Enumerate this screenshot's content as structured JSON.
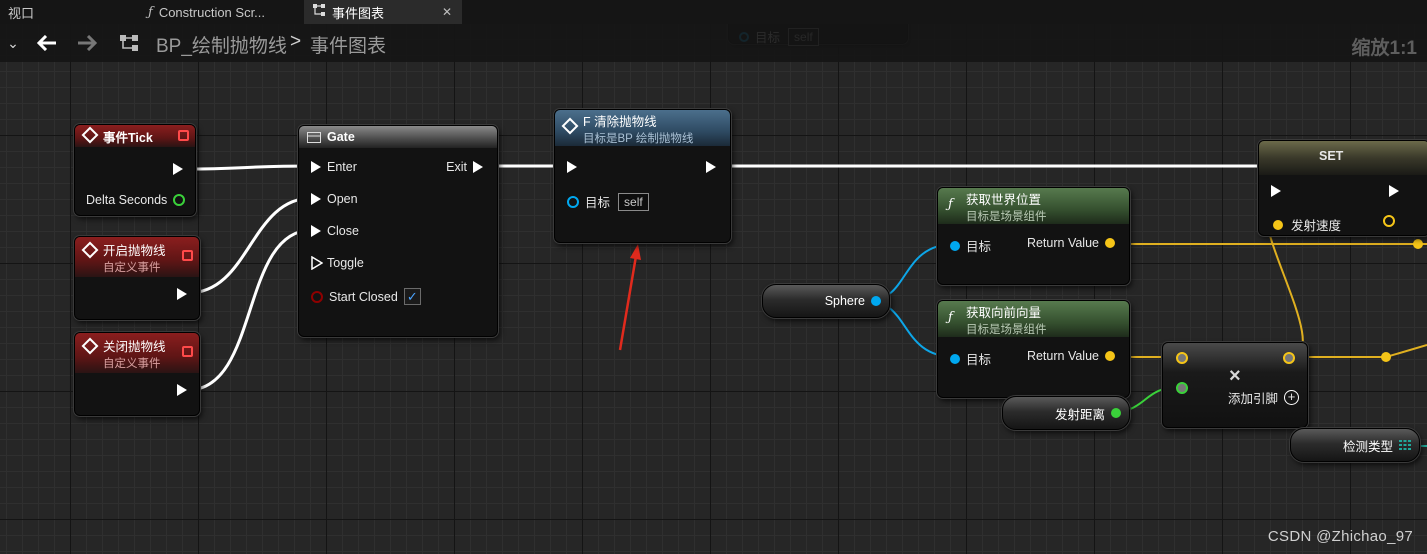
{
  "tabs": [
    {
      "label": "视口",
      "icon": "none",
      "active": false
    },
    {
      "label": "Construction Scr...",
      "icon": "function-icon",
      "active": false
    },
    {
      "label": "事件图表",
      "icon": "graph-icon",
      "active": true
    }
  ],
  "breadcrumb": {
    "blueprint": "BP_绘制抛物线",
    "separator": ">",
    "graph": "事件图表"
  },
  "zoom": "缩放1:1",
  "top_partial_node": {
    "pin_label": "目标",
    "value": "self"
  },
  "nodes": {
    "event_tick": {
      "title": "事件Tick",
      "pin_delta": "Delta Seconds"
    },
    "start_parabola": {
      "title": "开启抛物线",
      "subtitle": "自定义事件"
    },
    "close_parabola": {
      "title": "关闭抛物线",
      "subtitle": "自定义事件"
    },
    "gate": {
      "title": "Gate",
      "enter": "Enter",
      "exit": "Exit",
      "open": "Open",
      "close": "Close",
      "toggle": "Toggle",
      "start_closed": "Start Closed",
      "start_closed_checked": true
    },
    "clear_parabola": {
      "title": "F 清除抛物线",
      "subtitle": "目标是BP 绘制抛物线",
      "pin_target": "目标",
      "target_value": "self"
    },
    "get_world_location": {
      "title": "获取世界位置",
      "subtitle": "目标是场景组件",
      "pin_target": "目标",
      "return_value": "Return Value"
    },
    "get_forward_vector": {
      "title": "获取向前向量",
      "subtitle": "目标是场景组件",
      "pin_target": "目标",
      "return_value": "Return Value"
    },
    "set_node": {
      "title": "SET",
      "pin_label": "发射速度"
    },
    "sphere": {
      "label": "Sphere"
    },
    "launch_distance": {
      "label": "发射距离"
    },
    "multiply": {
      "symbol": "×",
      "add_pin": "添加引脚"
    },
    "trace_type": {
      "label": "检测类型"
    }
  },
  "watermark": "CSDN @Zhichao_97",
  "colors": {
    "exec": "#ffffff",
    "object_pin": "#00a8f0",
    "vector_pin": "#f5c518",
    "float_pin": "#3ad13a",
    "bool_pin": "#8e0000",
    "annotation_arrow": "#e02a1d"
  }
}
